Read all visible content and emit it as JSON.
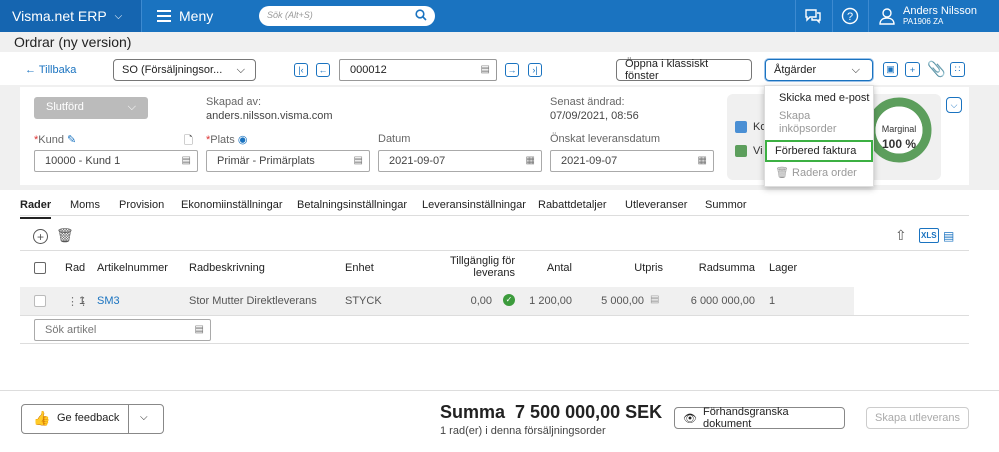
{
  "topbar": {
    "brand": "Visma.net ERP",
    "menu": "Meny",
    "search_placeholder": "Sök (Alt+S)",
    "user_name": "Anders Nilsson",
    "user_org": "PA1906 ZA"
  },
  "page": {
    "title": "Ordrar (ny version)"
  },
  "toolbar": {
    "back": "Tillbaka",
    "order_type": "SO (Försäljningsor...",
    "order_number": "000012",
    "classic_button": "Öppna i klassiskt fönster",
    "actions_button": "Åtgärder"
  },
  "actions_menu": {
    "item1": "Skicka med e-post",
    "item2_line1": "Skapa",
    "item2_line2": "inköpsorder",
    "item3": "Förbered faktura",
    "item4": "Radera order"
  },
  "header": {
    "status": "Slutförd",
    "created_by_label": "Skapad av:",
    "created_by_value": "anders.nilsson.visma.com",
    "last_changed_label": "Senast ändrad:",
    "last_changed_value": "07/09/2021, 08:56",
    "customer_label": "Kund",
    "customer_value": "10000 - Kund 1",
    "location_label": "Plats",
    "location_value": "Primär - Primärplats",
    "date_label": "Datum",
    "date_value": "2021-09-07",
    "delivery_label": "Önskat leveransdatum",
    "delivery_value": "2021-09-07",
    "legend1": "Ko",
    "legend2": "Vi",
    "margin_label": "Marginal",
    "margin_value": "100 %",
    "legend1_color": "#4a8fd4",
    "legend2_color": "#5c9e5c",
    "donut_color": "#5c9e5c"
  },
  "tabs": [
    "Rader",
    "Moms",
    "Provision",
    "Ekonomiinställningar",
    "Betalningsinställningar",
    "Leveransinställningar",
    "Rabattdetaljer",
    "Utleveranser",
    "Summor"
  ],
  "table": {
    "headers": {
      "rad": "Rad",
      "artikel": "Artikelnummer",
      "beskrivning": "Radbeskrivning",
      "enhet": "Enhet",
      "tillganglig1": "Tillgänglig för",
      "tillganglig2": "leverans",
      "antal": "Antal",
      "utpris": "Utpris",
      "radsumma": "Radsumma",
      "lager": "Lager"
    },
    "row": {
      "rad": "1",
      "artikel": "SM3",
      "beskrivning": "Stor Mutter Direktleverans",
      "enhet": "STYCK",
      "tillganglig": "0,00",
      "antal": "1 200,00",
      "utpris": "5 000,00",
      "radsumma": "6 000 000,00",
      "lager": "1"
    },
    "search_placeholder": "Sök artikel"
  },
  "footer": {
    "feedback": "Ge feedback",
    "sum_label": "Summa",
    "sum_value": "7 500 000,00 SEK",
    "rows_text": "1 rad(er) i denna försäljningsorder",
    "preview": "Förhandsgranska dokument",
    "create_delivery": "Skapa utleverans"
  }
}
